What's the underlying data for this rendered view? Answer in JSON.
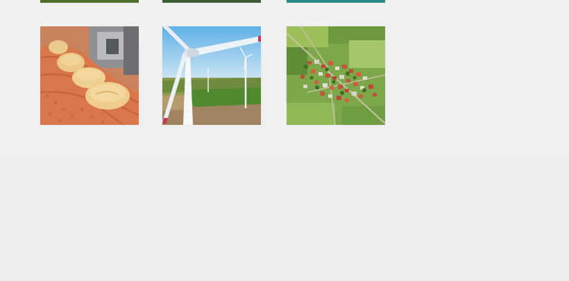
{
  "gallery": {
    "top_row": [
      {
        "name": "image-thumbnail",
        "color": "#4c6a2c"
      },
      {
        "name": "image-thumbnail",
        "color": "#3a5a35"
      },
      {
        "name": "image-thumbnail",
        "color": "#2f8a8a"
      }
    ],
    "items": [
      {
        "name": "bread-conveyor-thumbnail"
      },
      {
        "name": "wind-turbine-thumbnail"
      },
      {
        "name": "aerial-village-thumbnail"
      }
    ]
  }
}
